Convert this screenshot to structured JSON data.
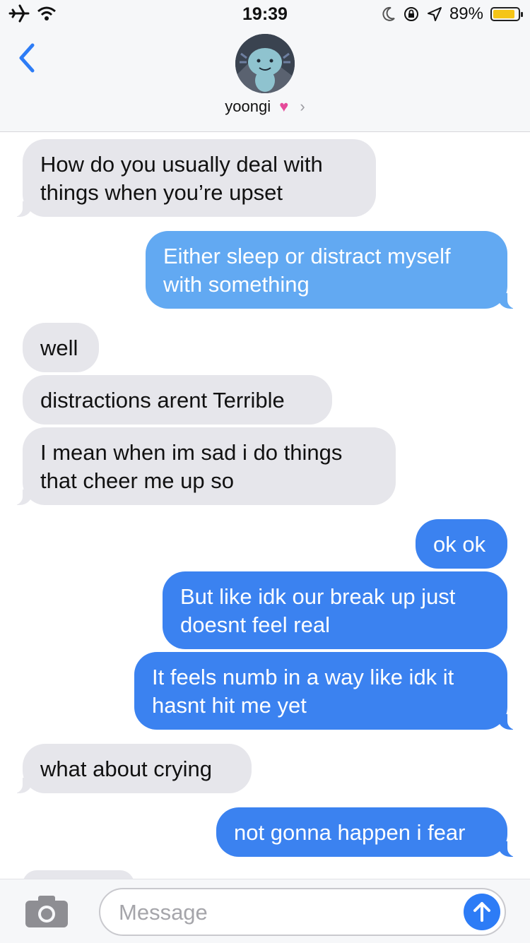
{
  "status": {
    "time": "19:39",
    "battery": "89%",
    "battery_level": 0.89
  },
  "header": {
    "contact_name": "yoongi"
  },
  "messages": [
    {
      "dir": "in",
      "text": "How do you usually deal with\nthings when you’re upset"
    },
    {
      "dir": "out",
      "text": "Either sleep or distract myself\nwith something"
    },
    {
      "dir": "in",
      "text": "well"
    },
    {
      "dir": "in",
      "text": "distractions arent Terrible"
    },
    {
      "dir": "in",
      "text": "I mean when im sad i do things\nthat cheer me up so"
    },
    {
      "dir": "out",
      "text": "ok ok"
    },
    {
      "dir": "out",
      "text": "But like idk our break up just\ndoesnt feel real"
    },
    {
      "dir": "out",
      "text": "It feels numb in a way like idk it\nhasnt hit me yet"
    },
    {
      "dir": "in",
      "text": "what about crying"
    },
    {
      "dir": "out",
      "text": "not gonna happen i fear"
    }
  ],
  "composer": {
    "placeholder": "Message"
  },
  "colors": {
    "accent": "#2d7cf6",
    "incoming_bubble": "#e6e6eb",
    "outgoing_bubble": "#3b82f0"
  }
}
